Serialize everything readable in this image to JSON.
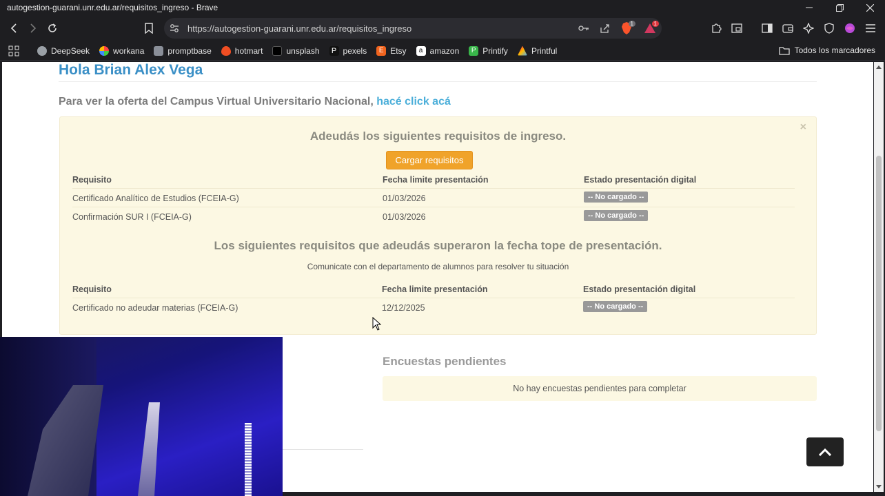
{
  "window": {
    "title": "autogestion-guarani.unr.edu.ar/requisitos_ingreso - Brave",
    "controls": [
      "minimize",
      "restore",
      "close"
    ]
  },
  "navbar": {
    "url": "https://autogestion-guarani.unr.edu.ar/requisitos_ingreso",
    "shield_count": "1",
    "alert_count": "1"
  },
  "bookmarks": {
    "items": [
      "DeepSeek",
      "workana",
      "promptbase",
      "hotmart",
      "unsplash",
      "pexels",
      "Etsy",
      "amazon",
      "Printify",
      "Printful"
    ],
    "all_bookmarks": "Todos los marcadores"
  },
  "page": {
    "greeting": "Hola Brian Alex Vega",
    "campus_text": "Para ver la oferta del Campus Virtual Universitario Nacional,",
    "campus_link": "hacé click acá",
    "alert": {
      "close": "×",
      "heading1": "Adeudás los siguientes requisitos de ingreso.",
      "button": "Cargar requisitos",
      "table1": {
        "headers": [
          "Requisito",
          "Fecha limite presentación",
          "Estado presentación digital"
        ],
        "rows": [
          {
            "requisito": "Certificado Analítico de Estudios (FCEIA-G)",
            "fecha": "01/03/2026",
            "estado": "-- No cargado --"
          },
          {
            "requisito": "Confirmación SUR I (FCEIA-G)",
            "fecha": "01/03/2026",
            "estado": "-- No cargado --"
          }
        ]
      },
      "heading2": "Los siguientes requisitos que adeudás superaron la fecha tope de presentación.",
      "note": "Comunicate con el departamento de alumnos para resolver tu situación",
      "table2": {
        "headers": [
          "Requisito",
          "Fecha limite presentación",
          "Estado presentación digital"
        ],
        "rows": [
          {
            "requisito": "Certificado no adeudar materias (FCEIA-G)",
            "fecha": "12/12/2025",
            "estado": "-- No cargado --"
          }
        ]
      }
    },
    "encuestas": {
      "title": "Encuestas pendientes",
      "message": "No hay encuestas pendientes para completar"
    }
  },
  "colors": {
    "link_blue": "#3a8fc6",
    "alert_bg": "#fcf8e3",
    "button_orange": "#f0a32a",
    "badge_gray": "#999999"
  }
}
